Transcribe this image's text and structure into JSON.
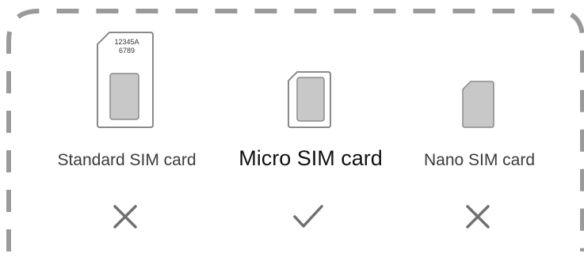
{
  "colors": {
    "frame_dash": "#9a9a9a",
    "card_outline": "#8a8a8a",
    "chip_fill": "#c8c8c8",
    "mark": "#707070"
  },
  "cards": [
    {
      "label": "Standard SIM card",
      "printed_number_line1": "12345A",
      "printed_number_line2": "6789",
      "status_icon": "cross-icon",
      "supported": false
    },
    {
      "label": "Micro SIM card",
      "status_icon": "check-icon",
      "supported": true
    },
    {
      "label": "Nano SIM card",
      "status_icon": "cross-icon",
      "supported": false
    }
  ]
}
